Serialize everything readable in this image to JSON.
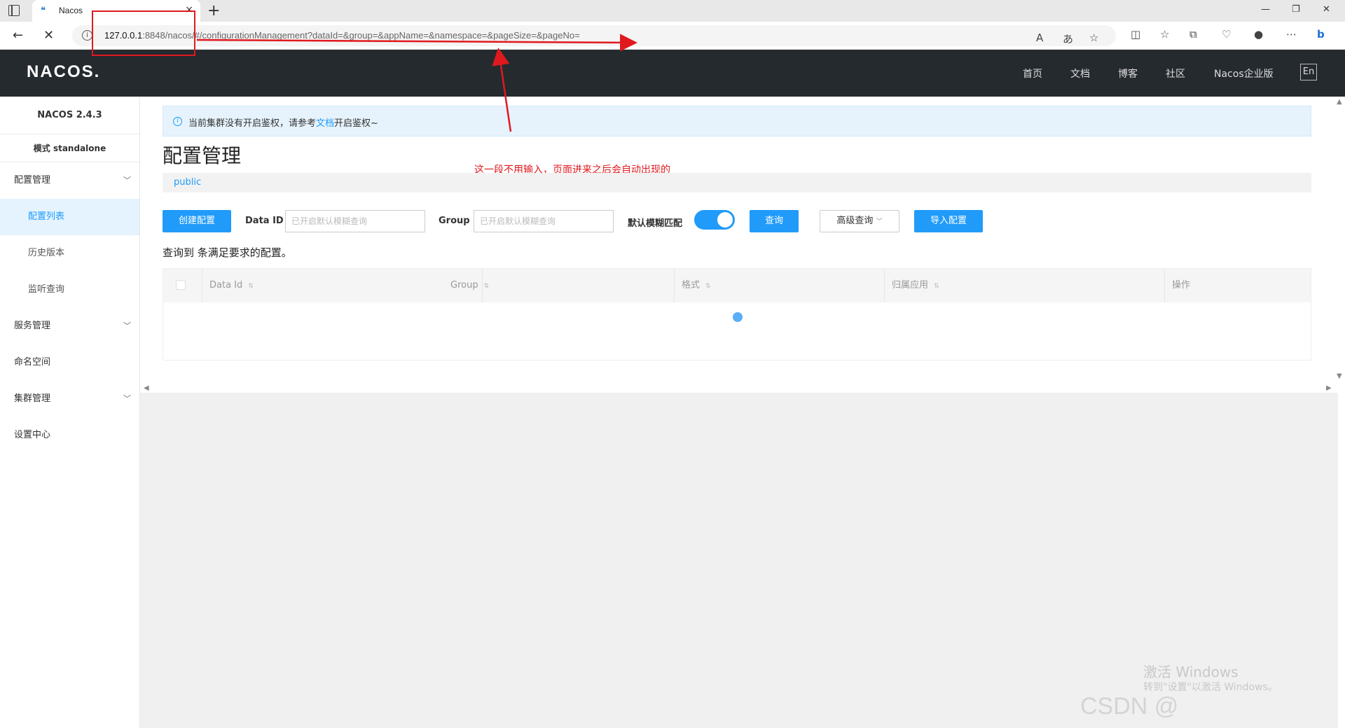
{
  "browser": {
    "tab_title": "Nacos",
    "tab_close": "×",
    "new_tab": "+",
    "url_host": "127.0.0.1",
    "url_rest": ":8848/nacos/#/configurationManagement?dataId=&group=&appName=&namespace=&pageSize=&pageNo=",
    "window_controls": [
      "—",
      "❐",
      "✕"
    ]
  },
  "header": {
    "logo": "NACOS.",
    "nav": [
      "首页",
      "文档",
      "博客",
      "社区",
      "Nacos企业版"
    ],
    "lang": "En"
  },
  "sidebar": {
    "version": "NACOS 2.4.3",
    "mode": "模式 standalone",
    "items": [
      {
        "label": "配置管理",
        "expandable": true
      },
      {
        "label": "配置列表",
        "sub": true,
        "active": true
      },
      {
        "label": "历史版本",
        "sub": true
      },
      {
        "label": "监听查询",
        "sub": true
      },
      {
        "label": "服务管理",
        "expandable": true
      },
      {
        "label": "命名空间"
      },
      {
        "label": "集群管理",
        "expandable": true
      },
      {
        "label": "设置中心"
      }
    ]
  },
  "notice": {
    "before": "当前集群没有开启鉴权，请参考",
    "link": "文档",
    "after": "开启鉴权~"
  },
  "page": {
    "title": "配置管理",
    "namespace": "public",
    "annotation": "这一段不用输入，页面进来之后会自动出现的"
  },
  "search": {
    "create_button": "创建配置",
    "dataid_label": "Data ID",
    "dataid_placeholder": "已开启默认模糊查询",
    "group_label": "Group",
    "group_placeholder": "已开启默认模糊查询",
    "fuzzy_label": "默认模糊匹配",
    "fuzzy_on": true,
    "query_button": "查询",
    "advanced_button": "高级查询",
    "import_button": "导入配置"
  },
  "result": {
    "text": "查询到 条满足要求的配置。"
  },
  "table": {
    "columns": [
      "Data Id",
      "Group",
      "格式",
      "归属应用",
      "操作"
    ]
  },
  "watermark": {
    "line1": "激活 Windows",
    "line2": "转到\"设置\"以激活 Windows。",
    "csdn": "CSDN @"
  },
  "colors": {
    "accent": "#209bfa",
    "header_bg": "#252a2f",
    "annotation": "#e0191e"
  }
}
